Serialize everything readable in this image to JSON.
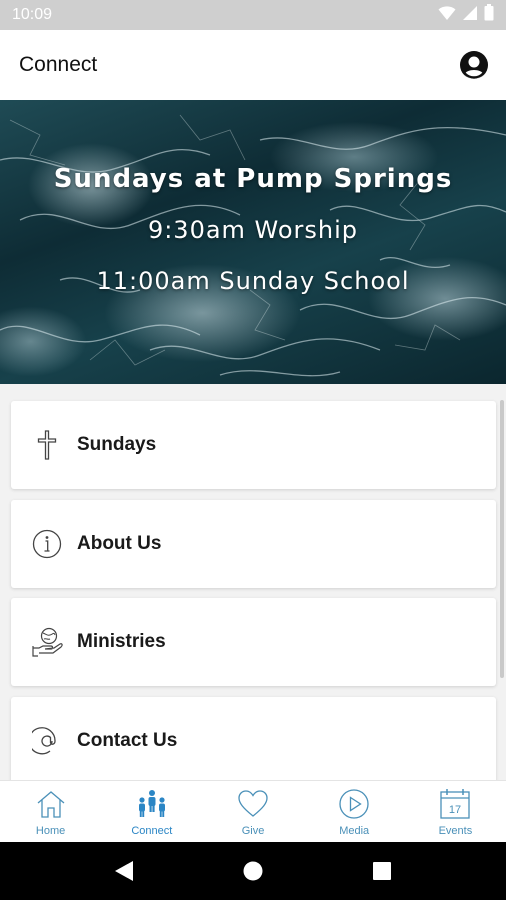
{
  "status_bar": {
    "time": "10:09"
  },
  "app_bar": {
    "title": "Connect"
  },
  "hero": {
    "title": "Sundays at Pump Springs",
    "line1": "9:30am Worship",
    "line2": "11:00am Sunday School"
  },
  "menu": [
    {
      "label": "Sundays",
      "icon": "cross-icon"
    },
    {
      "label": "About Us",
      "icon": "info-icon"
    },
    {
      "label": "Ministries",
      "icon": "hand-globe-icon"
    },
    {
      "label": "Contact Us",
      "icon": "at-sign-icon"
    }
  ],
  "tabs": [
    {
      "label": "Home",
      "icon": "home-icon"
    },
    {
      "label": "Connect",
      "icon": "people-icon",
      "active": true
    },
    {
      "label": "Give",
      "icon": "heart-icon"
    },
    {
      "label": "Media",
      "icon": "play-icon"
    },
    {
      "label": "Events",
      "icon": "calendar-icon",
      "date": "17"
    }
  ],
  "colors": {
    "accent": "#4a90b8",
    "active_tab": "#2b86c5",
    "status_bar": "#cfcfcf",
    "hero_dark": "#0e2c35"
  }
}
